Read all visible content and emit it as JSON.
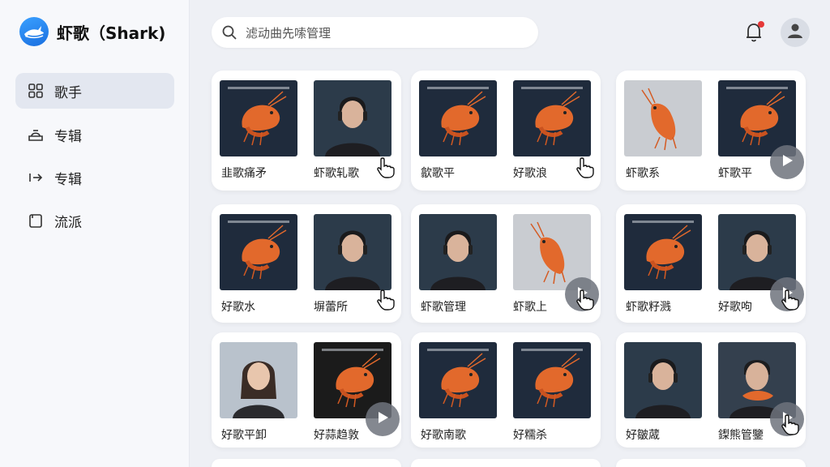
{
  "app": {
    "title": "虾歌（Shark)"
  },
  "nav": [
    {
      "label": "歌手",
      "icon": "grid-icon",
      "active": true
    },
    {
      "label": "专辑",
      "icon": "album-icon",
      "active": false
    },
    {
      "label": "专辑",
      "icon": "shuffle-icon",
      "active": false
    },
    {
      "label": "流派",
      "icon": "genre-icon",
      "active": false
    }
  ],
  "search": {
    "text": "滤动曲先嗦管理"
  },
  "header": {
    "bell_icon": "bell-icon",
    "notification_color": "#e63838",
    "user_icon": "user-icon"
  },
  "cards": [
    {
      "left": {
        "label": "韭歌痛矛",
        "image": "shrimp-dark"
      },
      "right": {
        "label": "虾歌轧歌",
        "image": "person"
      }
    },
    {
      "left": {
        "label": "歙歌平",
        "image": "shrimp-dark"
      },
      "right": {
        "label": "好歌浪",
        "image": "shrimp-dark"
      }
    },
    {
      "left": {
        "label": "虾歌系",
        "image": "shrimp-light"
      },
      "right": {
        "label": "虾歌平",
        "image": "shrimp-dark"
      }
    },
    {
      "left": {
        "label": "好歌水",
        "image": "shrimp-dark"
      },
      "right": {
        "label": "塀蕾所",
        "image": "person"
      }
    },
    {
      "left": {
        "label": "虾歌管理",
        "image": "person"
      },
      "right": {
        "label": "虾歌上",
        "image": "shrimp-light"
      }
    },
    {
      "left": {
        "label": "虾歌籽溅",
        "image": "shrimp-dark"
      },
      "right": {
        "label": "好歌呴",
        "image": "person"
      }
    },
    {
      "left": {
        "label": "好歌平卸",
        "image": "person-female"
      },
      "right": {
        "label": "好蒜趋敦",
        "image": "shrimp-black"
      }
    },
    {
      "left": {
        "label": "好歌南歌",
        "image": "shrimp-dark"
      },
      "right": {
        "label": "好糯杀",
        "image": "shrimp-dark"
      }
    },
    {
      "left": {
        "label": "好皺蒧",
        "image": "person"
      },
      "right": {
        "label": "鏫熊管鑒",
        "image": "person-shrimp"
      }
    }
  ],
  "colors": {
    "accent": "#1a6fe0",
    "active_nav": "#e3e7f0",
    "shrimp": "#e2692c"
  }
}
